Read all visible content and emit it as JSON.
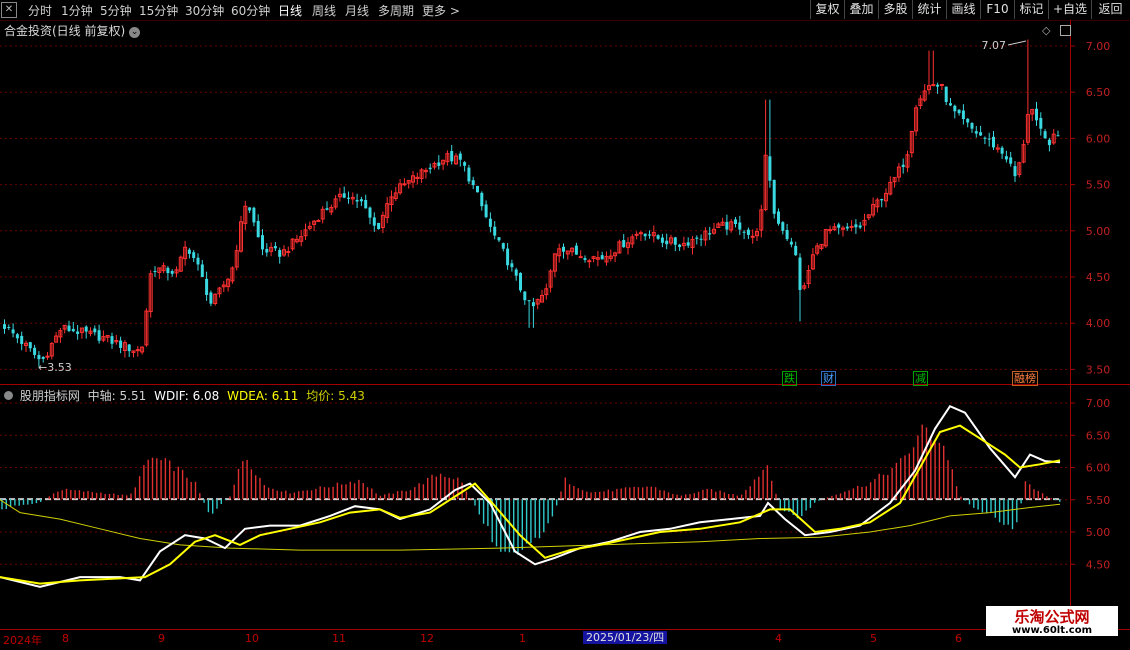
{
  "toolbar": {
    "periods": [
      "分时",
      "1分钟",
      "5分钟",
      "15分钟",
      "30分钟",
      "60分钟",
      "日线",
      "周线",
      "月线",
      "多周期",
      "更多 >"
    ],
    "active_period": "日线",
    "right_buttons": [
      "复权",
      "叠加",
      "多股",
      "统计",
      "画线",
      "F10",
      "标记",
      "+自选",
      "返回"
    ]
  },
  "main_title": "合金投资(日线 前复权)",
  "main_axis": [
    "7.00",
    "6.50",
    "6.00",
    "5.50",
    "5.00",
    "4.50",
    "4.00",
    "3.50"
  ],
  "main_annotations": {
    "high_label": "7.07",
    "low_label": "3.53",
    "low_arrow": "←3.53"
  },
  "event_tags": [
    {
      "text": "跌",
      "color": "#00c000"
    },
    {
      "text": "财",
      "color": "#4aa0ff"
    },
    {
      "text": "减",
      "color": "#00c000"
    },
    {
      "text": "融榜",
      "color": "#ff8040"
    }
  ],
  "indicator": {
    "name": "股朋指标网",
    "zhongzhou_label": "中轴:",
    "zhongzhou_value": "5.51",
    "wdif_label": "WDIF:",
    "wdif_value": "6.08",
    "wdea_label": "WDEA:",
    "wdea_value": "6.11",
    "junjia_label": "均价:",
    "junjia_value": "5.43",
    "axis": [
      "7.00",
      "6.50",
      "6.00",
      "5.50",
      "5.00",
      "4.50"
    ],
    "colors": {
      "zhongzhou": "#cccccc",
      "wdif": "#ffffff",
      "wdea": "#ffff00",
      "junjia": "#d0d000",
      "up": "#e03030",
      "down": "#30c8c8"
    }
  },
  "date_axis": [
    "2024年",
    "8",
    "9",
    "10",
    "11",
    "12",
    "1",
    "2025/01/23/四",
    "4",
    "5",
    "6"
  ],
  "watermark": {
    "line1": "乐淘公式网",
    "line2": "www.60lt.com"
  },
  "chart_data": {
    "type": "candlestick",
    "title": "合金投资(日线 前复权)",
    "annotated_high": 7.07,
    "annotated_low": 3.53,
    "ylim": [
      3.4,
      7.2
    ],
    "indicator_ylim": [
      4.2,
      7.2
    ],
    "indicator_last": {
      "中轴": 5.51,
      "WDIF": 6.08,
      "WDEA": 6.11,
      "均价": 5.43
    }
  }
}
